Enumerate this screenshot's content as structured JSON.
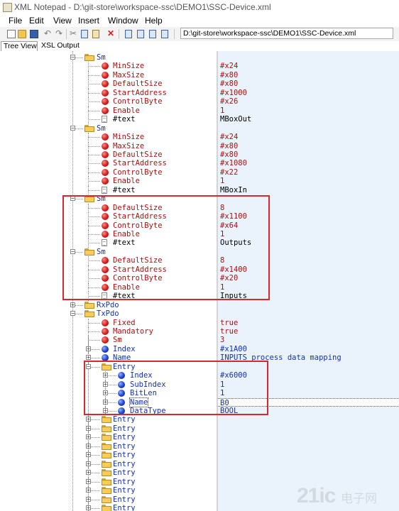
{
  "window": {
    "title": "XML Notepad - D:\\git-store\\workspace-ssc\\DEMO1\\SSC-Device.xml"
  },
  "menu": [
    "File",
    "Edit",
    "View",
    "Insert",
    "Window",
    "Help"
  ],
  "toolbar": {
    "icons": [
      "new-icon",
      "open-icon",
      "save-icon",
      "undo-icon",
      "redo-icon",
      "cut-icon",
      "copy-icon",
      "paste-icon",
      "delete-icon",
      "nudge-up-icon",
      "nudge-down-icon",
      "nudge-left-icon",
      "nudge-right-icon"
    ],
    "address": "D:\\git-store\\workspace-ssc\\DEMO1\\SSC-Device.xml"
  },
  "tabs": {
    "tree": "Tree View",
    "xsl": "XSL Output"
  },
  "tree": [
    {
      "name": "Sm",
      "type": "folder",
      "depth": 0,
      "value": ""
    },
    {
      "name": "MinSize",
      "type": "attr",
      "depth": 1,
      "value": "#x24"
    },
    {
      "name": "MaxSize",
      "type": "attr",
      "depth": 1,
      "value": "#x80"
    },
    {
      "name": "DefaultSize",
      "type": "attr",
      "depth": 1,
      "value": "#x80"
    },
    {
      "name": "StartAddress",
      "type": "attr",
      "depth": 1,
      "value": "#x1000"
    },
    {
      "name": "ControlByte",
      "type": "attr",
      "depth": 1,
      "value": "#x26"
    },
    {
      "name": "Enable",
      "type": "attr",
      "depth": 1,
      "value": "1"
    },
    {
      "name": "#text",
      "type": "text",
      "depth": 1,
      "value": "MBoxOut"
    },
    {
      "name": "Sm",
      "type": "folder",
      "depth": 0,
      "value": ""
    },
    {
      "name": "MinSize",
      "type": "attr",
      "depth": 1,
      "value": "#x24"
    },
    {
      "name": "MaxSize",
      "type": "attr",
      "depth": 1,
      "value": "#x80"
    },
    {
      "name": "DefaultSize",
      "type": "attr",
      "depth": 1,
      "value": "#x80"
    },
    {
      "name": "StartAddress",
      "type": "attr",
      "depth": 1,
      "value": "#x1080"
    },
    {
      "name": "ControlByte",
      "type": "attr",
      "depth": 1,
      "value": "#x22"
    },
    {
      "name": "Enable",
      "type": "attr",
      "depth": 1,
      "value": "1"
    },
    {
      "name": "#text",
      "type": "text",
      "depth": 1,
      "value": "MBoxIn"
    },
    {
      "name": "Sm",
      "type": "folder",
      "depth": 0,
      "value": ""
    },
    {
      "name": "DefaultSize",
      "type": "attr",
      "depth": 1,
      "value": "8"
    },
    {
      "name": "StartAddress",
      "type": "attr",
      "depth": 1,
      "value": "#x1100"
    },
    {
      "name": "ControlByte",
      "type": "attr",
      "depth": 1,
      "value": "#x64"
    },
    {
      "name": "Enable",
      "type": "attr",
      "depth": 1,
      "value": "1"
    },
    {
      "name": "#text",
      "type": "text",
      "depth": 1,
      "value": "Outputs"
    },
    {
      "name": "Sm",
      "type": "folder",
      "depth": 0,
      "value": ""
    },
    {
      "name": "DefaultSize",
      "type": "attr",
      "depth": 1,
      "value": "8"
    },
    {
      "name": "StartAddress",
      "type": "attr",
      "depth": 1,
      "value": "#x1400"
    },
    {
      "name": "ControlByte",
      "type": "attr",
      "depth": 1,
      "value": "#x20"
    },
    {
      "name": "Enable",
      "type": "attr",
      "depth": 1,
      "value": "1"
    },
    {
      "name": "#text",
      "type": "text",
      "depth": 1,
      "value": "Inputs"
    },
    {
      "name": "RxPdo",
      "type": "folder",
      "depth": 0,
      "value": ""
    },
    {
      "name": "TxPdo",
      "type": "folder",
      "depth": 0,
      "value": ""
    },
    {
      "name": "Fixed",
      "type": "attr",
      "depth": 1,
      "value": "true"
    },
    {
      "name": "Mandatory",
      "type": "attr",
      "depth": 1,
      "value": "true"
    },
    {
      "name": "Sm",
      "type": "attr",
      "depth": 1,
      "value": "3"
    },
    {
      "name": "Index",
      "type": "elem",
      "depth": 1,
      "value": "#x1A00"
    },
    {
      "name": "Name",
      "type": "elem",
      "depth": 1,
      "value": "INPUTS process data mapping"
    },
    {
      "name": "Entry",
      "type": "folder",
      "depth": 1,
      "value": ""
    },
    {
      "name": "Index",
      "type": "elem",
      "depth": 2,
      "value": "#x6000"
    },
    {
      "name": "SubIndex",
      "type": "elem",
      "depth": 2,
      "value": "1"
    },
    {
      "name": "BitLen",
      "type": "elem",
      "depth": 2,
      "value": "1"
    },
    {
      "name": "Name",
      "type": "elem",
      "depth": 2,
      "value": "B0"
    },
    {
      "name": "DataType",
      "type": "elem",
      "depth": 2,
      "value": "BOOL"
    },
    {
      "name": "Entry",
      "type": "folder",
      "depth": 1,
      "value": ""
    },
    {
      "name": "Entry",
      "type": "folder",
      "depth": 1,
      "value": ""
    },
    {
      "name": "Entry",
      "type": "folder",
      "depth": 1,
      "value": ""
    },
    {
      "name": "Entry",
      "type": "folder",
      "depth": 1,
      "value": ""
    },
    {
      "name": "Entry",
      "type": "folder",
      "depth": 1,
      "value": ""
    },
    {
      "name": "Entry",
      "type": "folder",
      "depth": 1,
      "value": ""
    },
    {
      "name": "Entry",
      "type": "folder",
      "depth": 1,
      "value": ""
    },
    {
      "name": "Entry",
      "type": "folder",
      "depth": 1,
      "value": ""
    },
    {
      "name": "Entry",
      "type": "folder",
      "depth": 1,
      "value": ""
    },
    {
      "name": "Entry",
      "type": "folder",
      "depth": 1,
      "value": ""
    },
    {
      "name": "Entry",
      "type": "folder",
      "depth": 1,
      "value": ""
    }
  ],
  "selected_node": "Name",
  "colors": {
    "annotation": "#d7282f",
    "attribute": "#a01515",
    "element": "#1532a8",
    "value_pane": "#eaf3fb"
  },
  "watermark": {
    "big": "21ic",
    "small": "电子网"
  }
}
